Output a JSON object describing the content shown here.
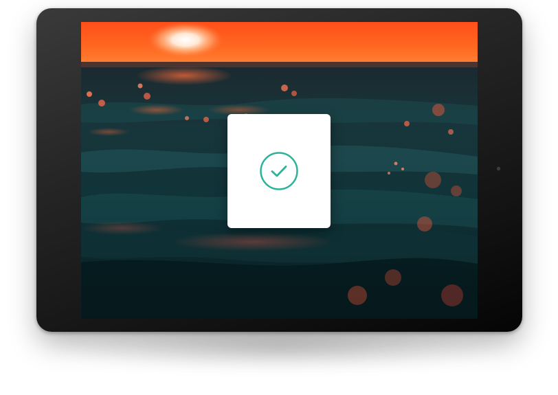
{
  "device": {
    "type": "tablet",
    "frame_color": "#1c1c1c"
  },
  "screen": {
    "wallpaper": "sunset-over-ocean-waves",
    "sky_color": "#ff5a1f",
    "water_color": "#0f3a3f"
  },
  "dialog": {
    "icon": "check-circle-icon",
    "accent_color": "#2bb39a",
    "status": "success"
  }
}
